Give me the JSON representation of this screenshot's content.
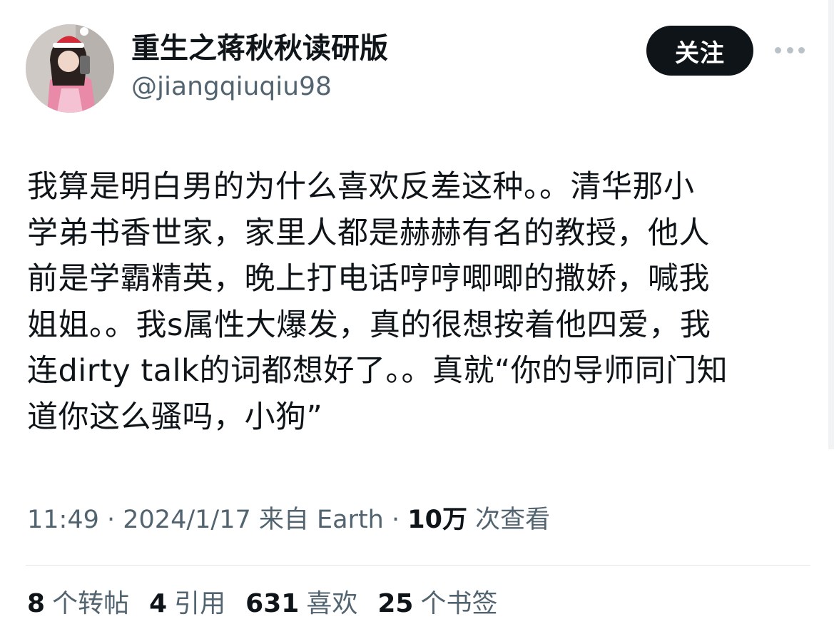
{
  "user": {
    "display_name": "重生之蒋秋秋读研版",
    "handle": "@jiangqiuqiu98",
    "follow_label": "关注"
  },
  "tweet": {
    "lines": [
      "我算是明白男的为什么喜欢反差这种。。清华那小",
      "学弟书香世家，家里人都是赫赫有名的教授，他人",
      "前是学霸精英，晚上打电话哼哼唧唧的撒娇，喊我",
      "姐姐。。我s属性大爆发，真的很想按着他四爱，我",
      "连dirty talk的词都想好了。。真就“你的导师同门知",
      "道你这么骚吗，小狗”"
    ]
  },
  "meta": {
    "time": "11:49",
    "separator": " · ",
    "date": "2024/1/17",
    "source": "来自 Earth",
    "views_count": "10万",
    "views_label": "次查看"
  },
  "stats": [
    {
      "count": "8",
      "label": "个转帖"
    },
    {
      "count": "4",
      "label": "引用"
    },
    {
      "count": "631",
      "label": "喜欢"
    },
    {
      "count": "25",
      "label": "个书签"
    }
  ],
  "icons": {
    "more": "more-horizontal-icon"
  },
  "colors": {
    "text_primary": "#0f1419",
    "text_secondary": "#536471",
    "button_bg": "#0f1419",
    "button_text": "#ffffff"
  }
}
